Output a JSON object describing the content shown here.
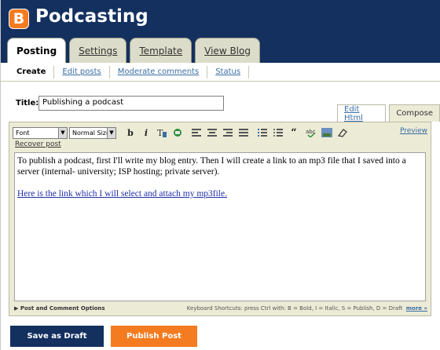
{
  "app": {
    "logo_letter": "B",
    "title": "Podcasting"
  },
  "main_tabs": [
    {
      "label": "Posting",
      "active": true
    },
    {
      "label": "Settings",
      "active": false
    },
    {
      "label": "Template",
      "active": false
    },
    {
      "label": "View Blog",
      "active": false
    }
  ],
  "sub_tabs": [
    {
      "label": "Create",
      "active": true
    },
    {
      "label": "Edit posts",
      "active": false
    },
    {
      "label": "Moderate comments",
      "active": false
    },
    {
      "label": "Status",
      "active": false
    }
  ],
  "post": {
    "title_label": "Title:",
    "title_value": "Publishing a podcast"
  },
  "editor_modes": {
    "edit_html": "Edit Html",
    "compose": "Compose",
    "active": "Compose"
  },
  "toolbar": {
    "font_select": "Font",
    "size_select": "Normal Size",
    "bold": "b",
    "italic": "i",
    "preview": "Preview",
    "recover_post": "Recover post"
  },
  "body": {
    "paragraph": "To publish a podcast, first I'll write my blog entry.  Then I will create a link to an mp3 file that I saved into a server (internal- university; ISP hosting; private server).",
    "link_text": "Here is the link which I will select and attach my mp3file."
  },
  "options": {
    "toggle": "Post and Comment Options",
    "shortcuts": "Keyboard Shortcuts: press Ctrl with: B = Bold, I = Italic, S = Publish, D = Draft",
    "more": "more »"
  },
  "actions": {
    "save_draft": "Save as Draft",
    "publish": "Publish Post"
  },
  "colors": {
    "header": "#13305f",
    "accent": "#f47b20",
    "editor_bg": "#ecebd6",
    "link": "#1f2ea8"
  }
}
